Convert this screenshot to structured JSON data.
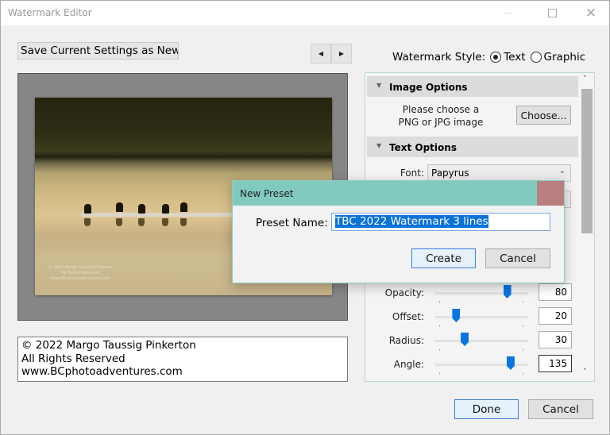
{
  "window": {
    "title": "Watermark Editor",
    "controls": {
      "minimize": "minimize",
      "maximize": "□",
      "close": "✕"
    }
  },
  "toolbar": {
    "preset_select": {
      "value": "Save Current Settings as New",
      "chevron": "⌄"
    },
    "prev_icon": "◀",
    "next_icon": "▶"
  },
  "watermark_style": {
    "label": "Watermark Style:",
    "options": [
      {
        "label": "Text",
        "selected": true
      },
      {
        "label": "Graphic",
        "selected": false
      }
    ]
  },
  "preview": {
    "watermark_lines": [
      "© 2022 Margo Taussig Pinkerton",
      "All Rights Reserved",
      "www.BCphotoadventures.com"
    ]
  },
  "watermark_text": {
    "lines": [
      "© 2022 Margo Taussig Pinkerton",
      "All Rights Reserved",
      "www.BCphotoadventures.com"
    ]
  },
  "panel": {
    "image_options": {
      "header": "Image Options",
      "prompt_line1": "Please choose a",
      "prompt_line2": "PNG or JPG image",
      "choose_button": "Choose..."
    },
    "text_options": {
      "header": "Text Options",
      "font_label": "Font:",
      "font_value": "Papyrus"
    },
    "sliders": [
      {
        "label": "Opacity:",
        "value": "80",
        "fraction": 0.8
      },
      {
        "label": "Offset:",
        "value": "20",
        "fraction": 0.2
      },
      {
        "label": "Radius:",
        "value": "30",
        "fraction": 0.3
      },
      {
        "label": "Angle:",
        "value": "135",
        "fraction": 0.84
      }
    ],
    "scroll_up": "˄",
    "scroll_down": "˅"
  },
  "footer": {
    "done": "Done",
    "cancel": "Cancel"
  },
  "modal": {
    "title": "New Preset",
    "field_label": "Preset Name:",
    "field_value": "TBC 2022 Watermark 3 lines",
    "create": "Create",
    "cancel": "Cancel"
  }
}
